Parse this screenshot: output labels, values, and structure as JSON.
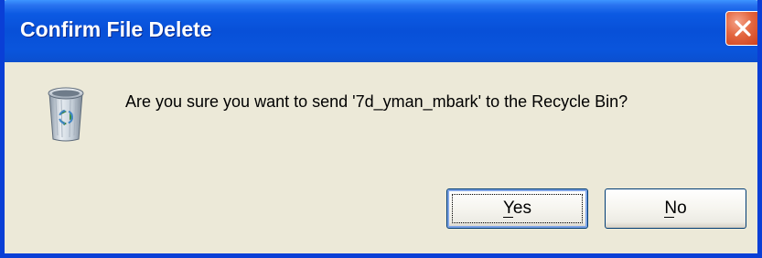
{
  "window": {
    "title": "Confirm File Delete"
  },
  "dialog": {
    "message": "Are you sure you want to send '7d_yman_mbark' to the Recycle Bin?",
    "icon": "recycle-bin-icon"
  },
  "buttons": {
    "yes_label": "Yes",
    "no_label": "No",
    "close_icon": "close-icon"
  },
  "colors": {
    "titlebar": "#0850d8",
    "frame": "#0a3fd6",
    "dialog_bg": "#ece9d8",
    "close_button": "#e3663f"
  }
}
